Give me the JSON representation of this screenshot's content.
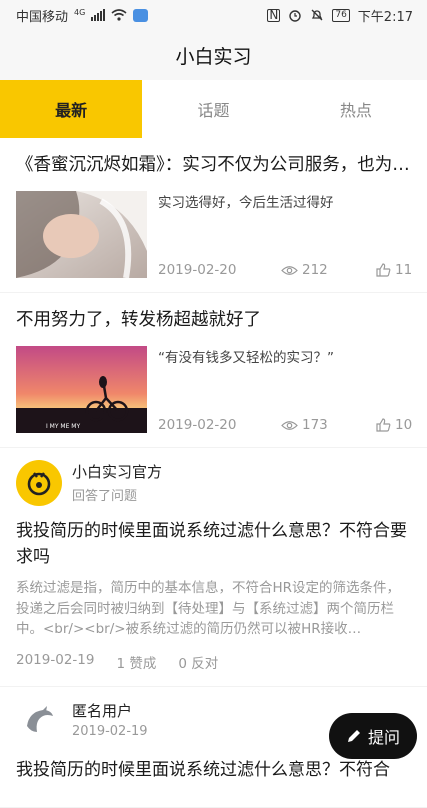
{
  "status": {
    "carrier": "中国移动",
    "net": "4G",
    "battery": "76",
    "time": "下午2:17"
  },
  "appbar": {
    "title": "小白实习"
  },
  "tabs": [
    {
      "label": "最新",
      "active": true
    },
    {
      "label": "话题",
      "active": false
    },
    {
      "label": "热点",
      "active": false
    }
  ],
  "articles": [
    {
      "title": "《香蜜沉沉烬如霜》：实习不仅为公司服务，也为自己成长",
      "excerpt": "实习选得好，今后生活过得好",
      "date": "2019-02-20",
      "views": "212",
      "likes": "11",
      "thumb_caption": ""
    },
    {
      "title": "不用努力了，转发杨超越就好了",
      "excerpt": "“有没有钱多又轻松的实习？”",
      "date": "2019-02-20",
      "views": "173",
      "likes": "10",
      "thumb_caption": "I MY ME MY"
    }
  ],
  "qa": [
    {
      "user": "小白实习官方",
      "sub": "回答了问题",
      "question": "我投简历的时候里面说系统过滤什么意思？不符合要求吗",
      "answer": "系统过滤是指，简历中的基本信息，不符合HR设定的筛选条件，投递之后会同时被归纳到【待处理】与【系统过滤】两个简历栏中。<br/><br/>被系统过滤的简历仍然可以被HR接收…",
      "date": "2019-02-19",
      "likes": "1 赞成",
      "dislikes": "0 反对"
    },
    {
      "user": "匿名用户",
      "sub": "2019-02-19",
      "question": "我投简历的时候里面说系统过滤什么意思？不符合"
    }
  ],
  "fab": {
    "label": "提问"
  },
  "colors": {
    "accent": "#f9c700",
    "fab": "#111111"
  }
}
